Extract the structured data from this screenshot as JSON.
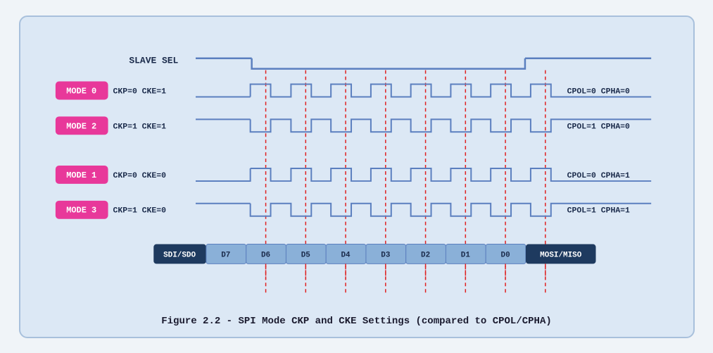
{
  "diagram": {
    "title": "Figure 2.2 - SPI Mode CKP and CKE Settings (compared to CPOL/CPHA)",
    "slave_sel_label": "SLAVE SEL",
    "modes": [
      {
        "label": "MODE 0",
        "params": "CKP=0  CKE=1",
        "right": "CPOL=0  CPHA=0"
      },
      {
        "label": "MODE 2",
        "params": "CKP=1  CKE=1",
        "right": "CPOL=1  CPHA=0"
      },
      {
        "label": "MODE 1",
        "params": "CKP=0  CKE=0",
        "right": "CPOL=0  CPHA=1"
      },
      {
        "label": "MODE 3",
        "params": "CKP=1  CKE=0",
        "right": "CPOL=1  CPHA=1"
      }
    ],
    "data_bits": [
      "SDI/SDO",
      "D7",
      "D6",
      "D5",
      "D4",
      "D3",
      "D2",
      "D1",
      "D0",
      "MOSI/MISO"
    ]
  }
}
